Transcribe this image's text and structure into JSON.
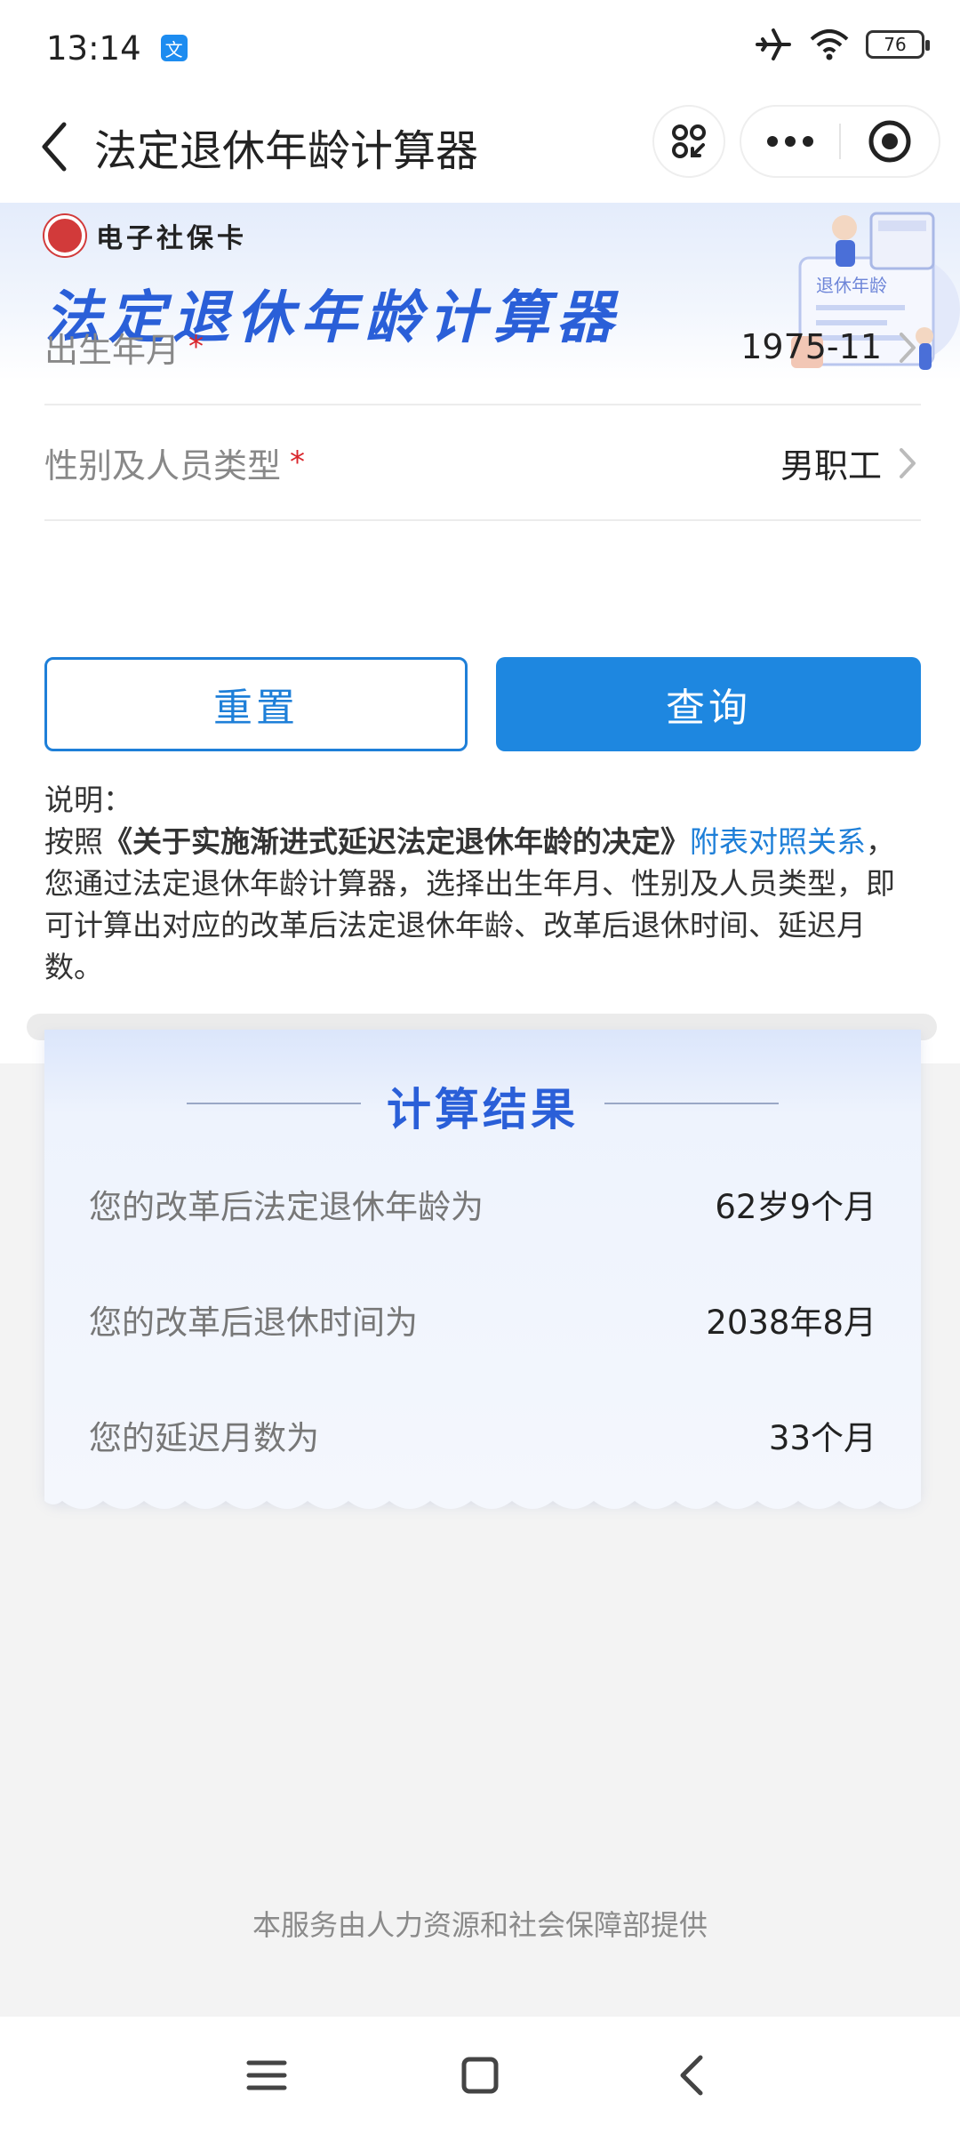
{
  "status_bar": {
    "time": "13:14",
    "app_badge": "文",
    "battery": "76"
  },
  "nav": {
    "title": "法定退休年龄计算器"
  },
  "banner": {
    "brand": "电子社保卡",
    "title": "法定退休年龄计算器",
    "illustration_label": "退休年龄"
  },
  "form": {
    "birth": {
      "label": "出生年月",
      "required_mark": "*",
      "value": "1975-11"
    },
    "type": {
      "label": "性别及人员类型",
      "required_mark": "*",
      "value": "男职工"
    }
  },
  "buttons": {
    "reset": "重置",
    "query": "查询"
  },
  "description": {
    "title": "说明：",
    "prefix": "按照",
    "doc_title": "《关于实施渐进式延迟法定退休年龄的决定》",
    "link": "附表对照关系",
    "suffix": "，您通过法定退休年龄计算器，选择出生年月、性别及人员类型，即可计算出对应的改革后法定退休年龄、改革后退休时间、延迟月数。"
  },
  "result": {
    "title": "计算结果",
    "rows": [
      {
        "label": "您的改革后法定退休年龄为",
        "value": "62岁9个月"
      },
      {
        "label": "您的改革后退休时间为",
        "value": "2038年8月"
      },
      {
        "label": "您的延迟月数为",
        "value": "33个月"
      }
    ]
  },
  "footer": {
    "note": "本服务由人力资源和社会保障部提供"
  },
  "colors": {
    "primary": "#1e87e0",
    "title_blue": "#2a5fd8",
    "required": "#d9252b"
  }
}
